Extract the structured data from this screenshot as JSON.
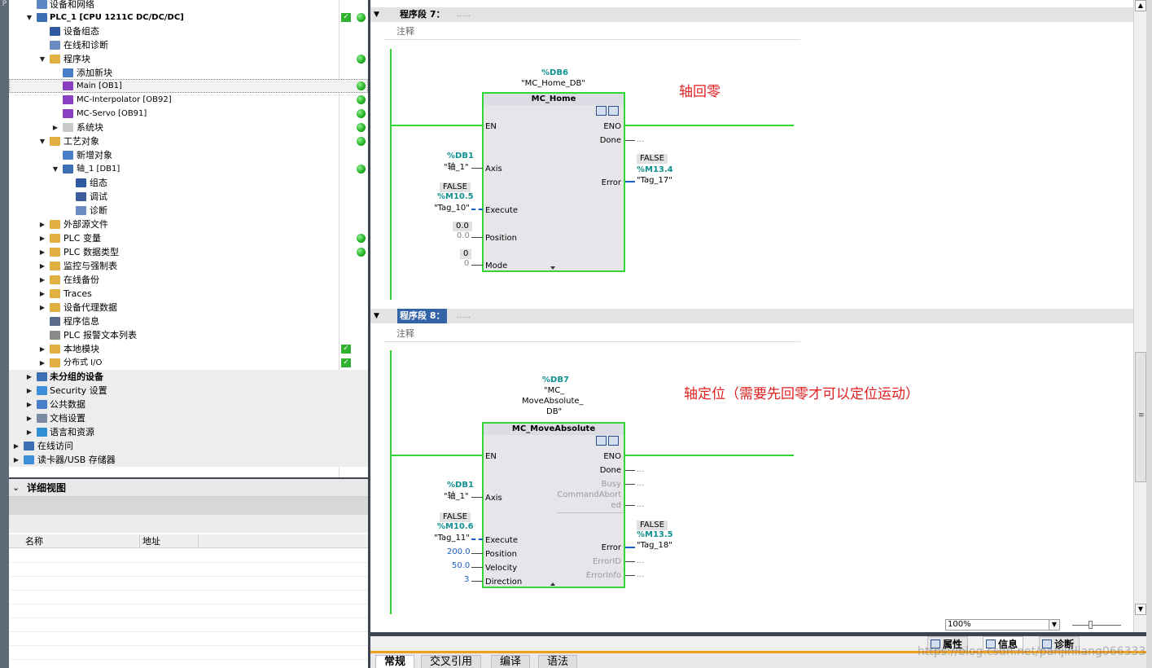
{
  "tree": {
    "items": [
      {
        "label": "设备和网络"
      },
      {
        "label": "PLC_1 [CPU 1211C DC/DC/DC]"
      },
      {
        "label": "设备组态"
      },
      {
        "label": "在线和诊断"
      },
      {
        "label": "程序块"
      },
      {
        "label": "添加新块"
      },
      {
        "label": "Main [OB1]"
      },
      {
        "label": "MC-Interpolator [OB92]"
      },
      {
        "label": "MC-Servo [OB91]"
      },
      {
        "label": "系统块"
      },
      {
        "label": "工艺对象"
      },
      {
        "label": "新增对象"
      },
      {
        "label": "轴_1 [DB1]"
      },
      {
        "label": "组态"
      },
      {
        "label": "调试"
      },
      {
        "label": "诊断"
      },
      {
        "label": "外部源文件"
      },
      {
        "label": "PLC 变量"
      },
      {
        "label": "PLC 数据类型"
      },
      {
        "label": "监控与强制表"
      },
      {
        "label": "在线备份"
      },
      {
        "label": "Traces"
      },
      {
        "label": "设备代理数据"
      },
      {
        "label": "程序信息"
      },
      {
        "label": "PLC 报警文本列表"
      },
      {
        "label": "本地模块"
      },
      {
        "label": "分布式 I/O"
      },
      {
        "label": "未分组的设备"
      },
      {
        "label": "Security 设置"
      },
      {
        "label": "公共数据"
      },
      {
        "label": "文档设置"
      },
      {
        "label": "语言和资源"
      },
      {
        "label": "在线访问"
      },
      {
        "label": "读卡器/USB 存储器"
      }
    ]
  },
  "detail": {
    "title": "详细视图",
    "col_name": "名称",
    "col_addr": "地址"
  },
  "editor": {
    "nw7": {
      "title": "程序段 7：",
      "dots": "......",
      "comment": "注释",
      "db_addr": "%DB6",
      "db_name": "\"MC_Home_DB\"",
      "fb_title": "MC_Home",
      "annotation": "轴回零",
      "pins_left": [
        "EN",
        "Axis",
        "Execute",
        "Position",
        "Mode"
      ],
      "pins_right": [
        "ENO",
        "Done",
        "Error"
      ],
      "axis_addr": "%DB1",
      "axis_name": "\"轴_1\"",
      "exec_state": "FALSE",
      "exec_addr": "%M10.5",
      "exec_name": "\"Tag_10\"",
      "pos_live": "0.0",
      "pos_val": "0.0",
      "mode_live": "0",
      "mode_val": "0",
      "done_out": "...",
      "err_state": "FALSE",
      "err_addr": "%M13.4",
      "err_name": "\"Tag_17\""
    },
    "nw8": {
      "title": "程序段 8：",
      "dots": "......",
      "comment": "注释",
      "db_addr": "%DB7",
      "db_name_1": "\"MC_",
      "db_name_2": "MoveAbsolute_",
      "db_name_3": "DB\"",
      "fb_title": "MC_MoveAbsolute",
      "annotation": "轴定位（需要先回零才可以定位运动）",
      "pins_left": [
        "EN",
        "Axis",
        "Execute",
        "Position",
        "Velocity",
        "Direction"
      ],
      "pins_right": [
        "ENO",
        "Done",
        "Busy",
        "CommandAbort",
        "ed",
        "Error",
        "ErrorID",
        "ErrorInfo"
      ],
      "axis_addr": "%DB1",
      "axis_name": "\"轴_1\"",
      "exec_state": "FALSE",
      "exec_addr": "%M10.6",
      "exec_name": "\"Tag_11\"",
      "pos_val": "200.0",
      "vel_val": "50.0",
      "dir_val": "3",
      "out_dots": "...",
      "err_state": "FALSE",
      "err_addr": "%M13.5",
      "err_name": "\"Tag_18\""
    }
  },
  "zoom": {
    "value": "100%"
  },
  "inspector": {
    "tab_props": "属性",
    "tab_info": "信息",
    "tab_diag": "诊断"
  },
  "bottom_tabs": [
    "常规",
    "交叉引用",
    "编译",
    "语法"
  ],
  "watermark": "https://blog.csdn.net/panjinliang066333",
  "colors": {
    "accent_green": "#34d634",
    "teal": "#109090",
    "annotation_red": "#e02020",
    "orange": "#f0a020"
  }
}
